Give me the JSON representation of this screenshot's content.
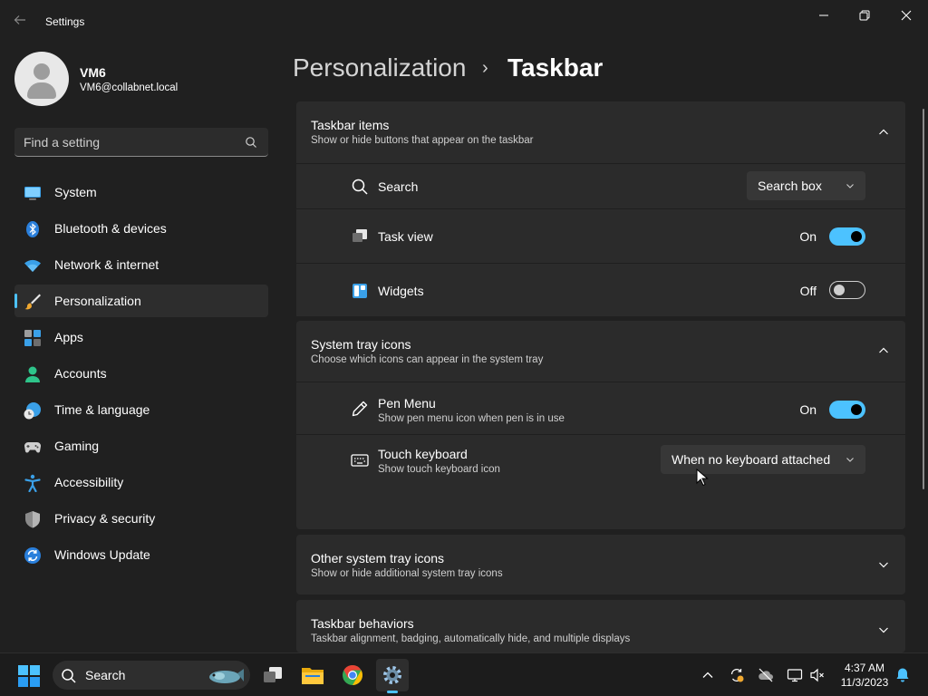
{
  "window": {
    "app_title": "Settings"
  },
  "profile": {
    "name": "VM6",
    "email": "VM6@collabnet.local"
  },
  "search": {
    "placeholder": "Find a setting"
  },
  "nav": {
    "active": "Personalization",
    "items": [
      {
        "label": "System",
        "icon": "monitor-icon"
      },
      {
        "label": "Bluetooth & devices",
        "icon": "bluetooth-icon"
      },
      {
        "label": "Network & internet",
        "icon": "wifi-icon"
      },
      {
        "label": "Personalization",
        "icon": "brush-icon"
      },
      {
        "label": "Apps",
        "icon": "apps-icon"
      },
      {
        "label": "Accounts",
        "icon": "person-icon"
      },
      {
        "label": "Time & language",
        "icon": "globe-clock-icon"
      },
      {
        "label": "Gaming",
        "icon": "gamepad-icon"
      },
      {
        "label": "Accessibility",
        "icon": "accessibility-icon"
      },
      {
        "label": "Privacy & security",
        "icon": "shield-icon"
      },
      {
        "label": "Windows Update",
        "icon": "update-icon"
      }
    ]
  },
  "breadcrumb": {
    "parent": "Personalization",
    "separator": "›",
    "current": "Taskbar"
  },
  "sections": {
    "taskbar_items": {
      "title": "Taskbar items",
      "subtitle": "Show or hide buttons that appear on the taskbar",
      "expanded": true,
      "rows": {
        "search": {
          "label": "Search",
          "value": "Search box",
          "icon": "search-icon"
        },
        "task_view": {
          "label": "Task view",
          "state": "On",
          "on": true,
          "icon": "task-view-icon"
        },
        "widgets": {
          "label": "Widgets",
          "state": "Off",
          "on": false,
          "icon": "widgets-icon"
        }
      }
    },
    "system_tray": {
      "title": "System tray icons",
      "subtitle": "Choose which icons can appear in the system tray",
      "expanded": true,
      "rows": {
        "pen_menu": {
          "label": "Pen Menu",
          "description": "Show pen menu icon when pen is in use",
          "state": "On",
          "on": true,
          "icon": "pen-icon"
        },
        "touch_keyboard": {
          "label": "Touch keyboard",
          "description": "Show touch keyboard icon",
          "value": "When no keyboard attached",
          "icon": "keyboard-icon"
        }
      }
    },
    "other_tray": {
      "title": "Other system tray icons",
      "subtitle": "Show or hide additional system tray icons",
      "expanded": false
    },
    "behaviors": {
      "title": "Taskbar behaviors",
      "subtitle": "Taskbar alignment, badging, automatically hide, and multiple displays",
      "expanded": false
    }
  },
  "taskbar": {
    "search_label": "Search",
    "clock": {
      "time": "4:37 AM",
      "date": "11/3/2023"
    }
  },
  "colors": {
    "accent": "#4cc2ff",
    "background": "#202020",
    "card": "#2b2b2b"
  }
}
